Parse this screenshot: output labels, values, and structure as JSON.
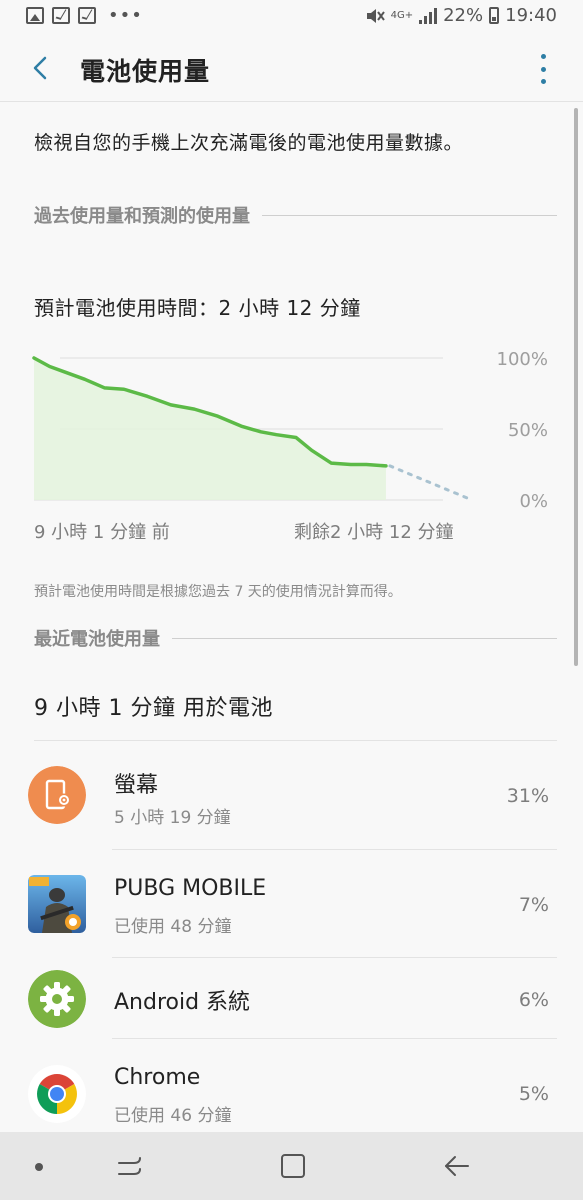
{
  "status_bar": {
    "network": "4G+",
    "battery": "22%",
    "time": "19:40"
  },
  "app_bar": {
    "title": "電池使用量"
  },
  "intro": "檢視自您的手機上次充滿電後的電池使用量數據。",
  "history_section": {
    "header": "過去使用量和預測的使用量",
    "estimate": "預計電池使用時間：2 小時 12 分鐘",
    "x_start_label": "9 小時 1 分鐘 前",
    "x_end_label": "剩餘2 小時 12 分鐘",
    "note": "預計電池使用時間是根據您過去 7 天的使用情況計算而得。"
  },
  "chart_data": {
    "type": "area",
    "ylim": [
      0,
      100
    ],
    "yticks": [
      "100%",
      "50%",
      "0%"
    ],
    "grid": true,
    "colors": {
      "actual": "#5cba47",
      "fill": "#e4f3dd",
      "predicted": "#a9c2d0"
    },
    "actual": {
      "x": [
        0,
        0.4,
        0.8,
        1.3,
        1.8,
        2.3,
        2.9,
        3.5,
        4.1,
        4.7,
        5.3,
        5.8,
        6.2,
        6.7,
        7.1,
        7.6,
        8.1,
        8.5,
        9.0
      ],
      "y": [
        100,
        94,
        90,
        85,
        79,
        78,
        73,
        67,
        64,
        59,
        52,
        48,
        46,
        44,
        35,
        26,
        25,
        25,
        24
      ]
    },
    "predicted": {
      "x": [
        9.0,
        11.2
      ],
      "y": [
        24,
        0
      ]
    }
  },
  "recent_section": {
    "header": "最近電池使用量",
    "total": "9 小時 1 分鐘 用於電池"
  },
  "apps": [
    {
      "name": "螢幕",
      "detail": "5 小時 19 分鐘",
      "percent": "31%",
      "icon": "screen-icon",
      "color": "#ef8c4f"
    },
    {
      "name": "PUBG MOBILE",
      "detail": "已使用 48 分鐘",
      "percent": "7%",
      "icon": "pubg-icon",
      "color": "#3f82c9"
    },
    {
      "name": "Android 系統",
      "detail": "",
      "percent": "6%",
      "icon": "android-system-gear-icon",
      "color": "#7cb342"
    },
    {
      "name": "Chrome",
      "detail": "已使用 46 分鐘",
      "percent": "5%",
      "icon": "chrome-icon",
      "color": "#ffffff"
    }
  ]
}
